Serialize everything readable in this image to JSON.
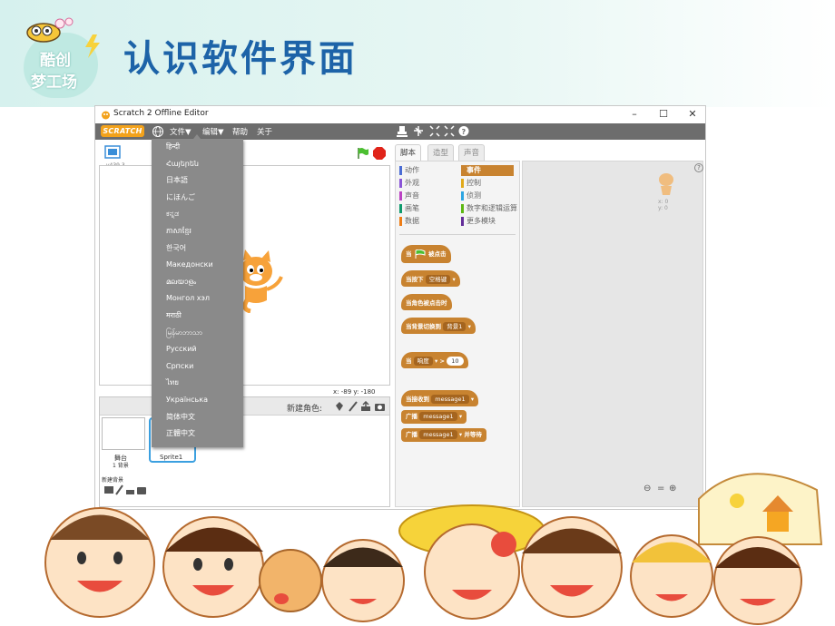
{
  "slide": {
    "title": "认识软件界面",
    "logo_line1": "酷创",
    "logo_line2": "梦工场"
  },
  "window": {
    "title": "Scratch 2 Offline Editor",
    "minimize": "–",
    "maximize": "☐",
    "close": "✕"
  },
  "menubar": {
    "logo": "SCRATCH",
    "file": "文件▼",
    "edit": "编辑▼",
    "help": "帮助",
    "about": "关于"
  },
  "language_menu": {
    "items": [
      "हिन्दी",
      "Հայերեն",
      "日本語",
      "にほんご",
      "ಕನ್ನಡ",
      "ភាសាខ្មែរ",
      "한국어",
      "Македонски",
      "മലയാളം",
      "Монгол хэл",
      "मराठी",
      "မြန်မာဘာသာ",
      "Русский",
      "Српски",
      "ไทย",
      "Українська",
      "简体中文",
      "正體中文"
    ]
  },
  "stage": {
    "version": "v439.3",
    "coords": "x: -89   y: -180"
  },
  "sprites": {
    "new_sprite_label": "新建角色:",
    "stage_label": "舞台",
    "backdrop_count": "1 背景",
    "new_backdrop_label": "新建背景",
    "sprite_name": "Sprite1"
  },
  "tabs": {
    "scripts": "脚本",
    "costumes": "造型",
    "sounds": "声音"
  },
  "categories": [
    {
      "label": "动作",
      "color": "#4a6cd4"
    },
    {
      "label": "外观",
      "color": "#8a55d7"
    },
    {
      "label": "声音",
      "color": "#bb42c3"
    },
    {
      "label": "画笔",
      "color": "#0e9a6c"
    },
    {
      "label": "数据",
      "color": "#ee7d16"
    },
    {
      "label": "事件",
      "color": "#c88330"
    },
    {
      "label": "控制",
      "color": "#e1a91a"
    },
    {
      "label": "侦测",
      "color": "#2ca5e2"
    },
    {
      "label": "数字和逻辑运算",
      "color": "#5cb712"
    },
    {
      "label": "更多模块",
      "color": "#632d99"
    }
  ],
  "blocks": {
    "when_flag": "当",
    "when_flag_suffix": "被点击",
    "when_key": "当按下",
    "key_value": "空格键",
    "when_sprite_clicked": "当角色被点击时",
    "when_backdrop": "当背景切换到",
    "backdrop_value": "背景1",
    "when_sensor": "当",
    "sensor_value": "响度",
    "sensor_num": "10",
    "when_receive": "当接收到",
    "message1": "message1",
    "broadcast": "广播",
    "broadcast_wait_suffix": "并等待"
  },
  "sprite_info": {
    "x": "x: 0",
    "y": "y: 0"
  },
  "colors": {
    "accent": "#1d63a8",
    "scratch_orange": "#f3a21b",
    "events_block": "#c88330",
    "menubar": "#6d6d6d"
  }
}
